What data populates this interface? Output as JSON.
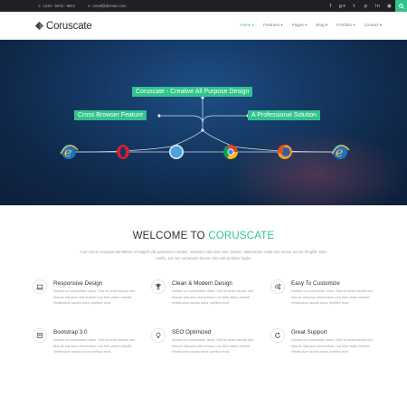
{
  "topbar": {
    "phone": "1234 - 5678 - 9612",
    "email": "email@domain.com",
    "social_icons": [
      "facebook-icon",
      "google-plus-icon",
      "twitter-icon",
      "pinterest-icon",
      "linkedin-icon",
      "rss-icon",
      "search-icon"
    ]
  },
  "brand": {
    "name": "Coruscate",
    "accent": "#31c48d"
  },
  "nav": {
    "items": [
      {
        "label": "Home ▾",
        "active": true
      },
      {
        "label": "Features ▾"
      },
      {
        "label": "Pages ▾"
      },
      {
        "label": "Blog ▾"
      },
      {
        "label": "Portfolio ▾"
      },
      {
        "label": "Contact ▾"
      }
    ]
  },
  "hero": {
    "tag_main": "Coruscate - Creative All Purpose Design",
    "tag_left": "Cross Browser Feature",
    "tag_right": "A Professional Solution",
    "browsers": [
      "internet-explorer-icon",
      "opera-icon",
      "safari-icon",
      "chrome-icon",
      "firefox-icon",
      "internet-explorer-icon"
    ]
  },
  "welcome": {
    "title_prefix": "WELCOME TO",
    "title_accent": "CORUSCATE",
    "intro": "Cum sociis natoque penatibus et magnis dis parturient montes, nascetur ridiculus mus. Donec ullamcorper nulla non metus auctor fringilla. Duis mollis, est non commodo luctus, nisi erat porttitor ligula."
  },
  "features": [
    {
      "icon": "laptop-icon",
      "title": "Responsive Design",
      "desc": "Nullam ut consectetur dolor. Sed sit amet iaculis nisi. Mauris ridiculus elementum non felis etiam blandit. Vestibulum iaculis dolor porttitor erat."
    },
    {
      "icon": "trophy-icon",
      "title": "Clean & Modern Design",
      "desc": "Nullam ut consectetur dolor. Sed sit amet iaculis nisi. Mauris ridiculus elementum non felis etiam blandit. Vestibulum iaculis dolor porttitor erat."
    },
    {
      "icon": "gears-icon",
      "title": "Easy To Customize",
      "desc": "Nullam ut consectetur dolor. Sed sit amet iaculis nisi. Mauris ridiculus elementum non felis etiam blandit. Vestibulum iaculis dolor porttitor erat."
    },
    {
      "icon": "box-icon",
      "title": "Bootstrap 3.0",
      "desc": "Nullam ut consectetur dolor. Sed sit amet iaculis nisi. Mauris ridiculus elementum non felis etiam blandit. Vestibulum iaculis dolor porttitor erat."
    },
    {
      "icon": "lightbulb-icon",
      "title": "SEO Optimized",
      "desc": "Nullam ut consectetur dolor. Sed sit amet iaculis nisi. Mauris ridiculus elementum non felis etiam blandit. Vestibulum iaculis dolor porttitor erat."
    },
    {
      "icon": "refresh-icon",
      "title": "Great Support",
      "desc": "Nullam ut consectetur dolor. Sed sit amet iaculis nisi. Mauris ridiculus elementum non felis etiam blandit. Vestibulum iaculis dolor porttitor erat."
    }
  ]
}
